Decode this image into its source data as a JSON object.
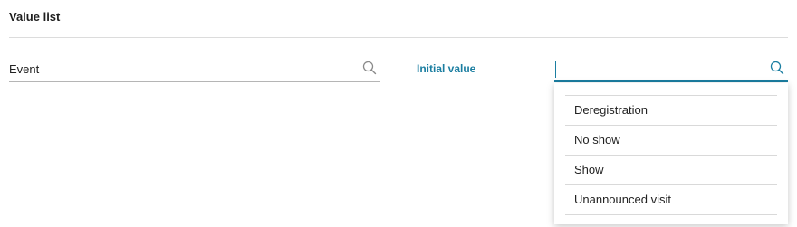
{
  "section": {
    "title": "Value list"
  },
  "event_field": {
    "value": "Event",
    "icon": "search-icon"
  },
  "initial_value": {
    "label": "Initial value",
    "value": "",
    "icon": "search-icon"
  },
  "dropdown": {
    "options": [
      {
        "label": "Deregistration"
      },
      {
        "label": "No show"
      },
      {
        "label": "Show"
      },
      {
        "label": "Unannounced visit"
      }
    ]
  },
  "colors": {
    "accent": "#1b7ea1",
    "divider": "#dcdcdc",
    "text": "#222222"
  }
}
